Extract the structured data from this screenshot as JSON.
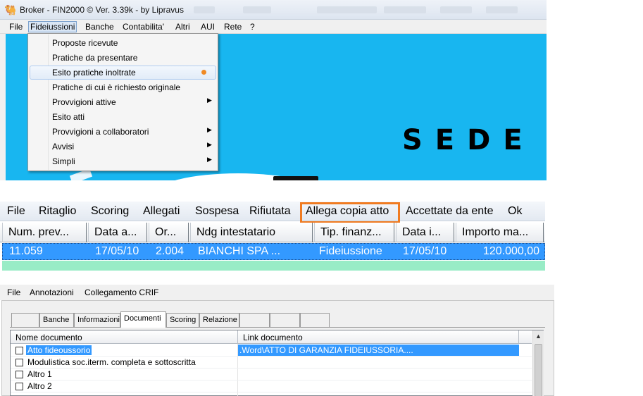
{
  "window": {
    "title": "Broker - FIN2000 © Ver.  3.39k - by Lipravus",
    "app_icon": "camel-icon",
    "menu": [
      "File",
      "Fideiussioni",
      "Banche",
      "Contabilita'",
      "Altri",
      "AUI",
      "Rete",
      "?"
    ],
    "active_menu": "Fideiussioni",
    "dropdown": [
      {
        "label": "Proposte ricevute",
        "submenu": false
      },
      {
        "label": "Pratiche da presentare",
        "submenu": false
      },
      {
        "label": "Esito pratiche inoltrate",
        "submenu": false,
        "highlighted": true,
        "marker": "orange-dot"
      },
      {
        "label": "Pratiche di cui è richiesto originale",
        "submenu": false
      },
      {
        "label": "Provvigioni attive",
        "submenu": true
      },
      {
        "label": "Esito atti",
        "submenu": false
      },
      {
        "label": "Provvigioni a collaboratori",
        "submenu": true
      },
      {
        "label": "Avvisi",
        "submenu": true
      },
      {
        "label": "Simpli",
        "submenu": true
      }
    ],
    "background_text": "SEDE",
    "colors": {
      "background": "#18b6f0",
      "highlight": "#3399ff",
      "marker": "#f08a24"
    }
  },
  "grid_toolbar": {
    "items": [
      "File",
      "Ritaglio",
      "Scoring",
      "Allegati",
      "Sospesa",
      "Rifiutata",
      "Allega copia atto",
      "Accettate da ente",
      "Ok"
    ],
    "highlighted": "Allega copia atto",
    "highlight_color": "#f07b21",
    "columns": [
      "Num. prev...",
      "Data a...",
      "Or...",
      "Ndg intestatario",
      "Tip. finanz...",
      "Data i...",
      "Importo ma..."
    ],
    "rows": [
      [
        "11.059",
        "17/05/10",
        "2.004",
        "BIANCHI SPA  ...",
        "Fideiussione",
        "17/05/10",
        "120.000,00"
      ]
    ]
  },
  "documents_window": {
    "menu": [
      "File",
      "Annotazioni",
      "Collegamento CRIF"
    ],
    "tabs": [
      "",
      "Banche",
      "Informazioni",
      "Documenti",
      "Scoring",
      "Relazione",
      "",
      "",
      ""
    ],
    "selected_tab": "Documenti",
    "columns": [
      "Nome documento",
      "Link documento"
    ],
    "rows": [
      {
        "name": "Atto fideoussorio",
        "link": ".Word\\ATTO DI GARANZIA FIDEIUSSORIA....",
        "checked": false,
        "selected": true
      },
      {
        "name": "Modulistica soc.iterm. completa e sottoscritta",
        "link": "",
        "checked": false,
        "selected": false
      },
      {
        "name": "Altro 1",
        "link": "",
        "checked": false,
        "selected": false
      },
      {
        "name": "Altro 2",
        "link": "",
        "checked": false,
        "selected": false
      }
    ]
  }
}
